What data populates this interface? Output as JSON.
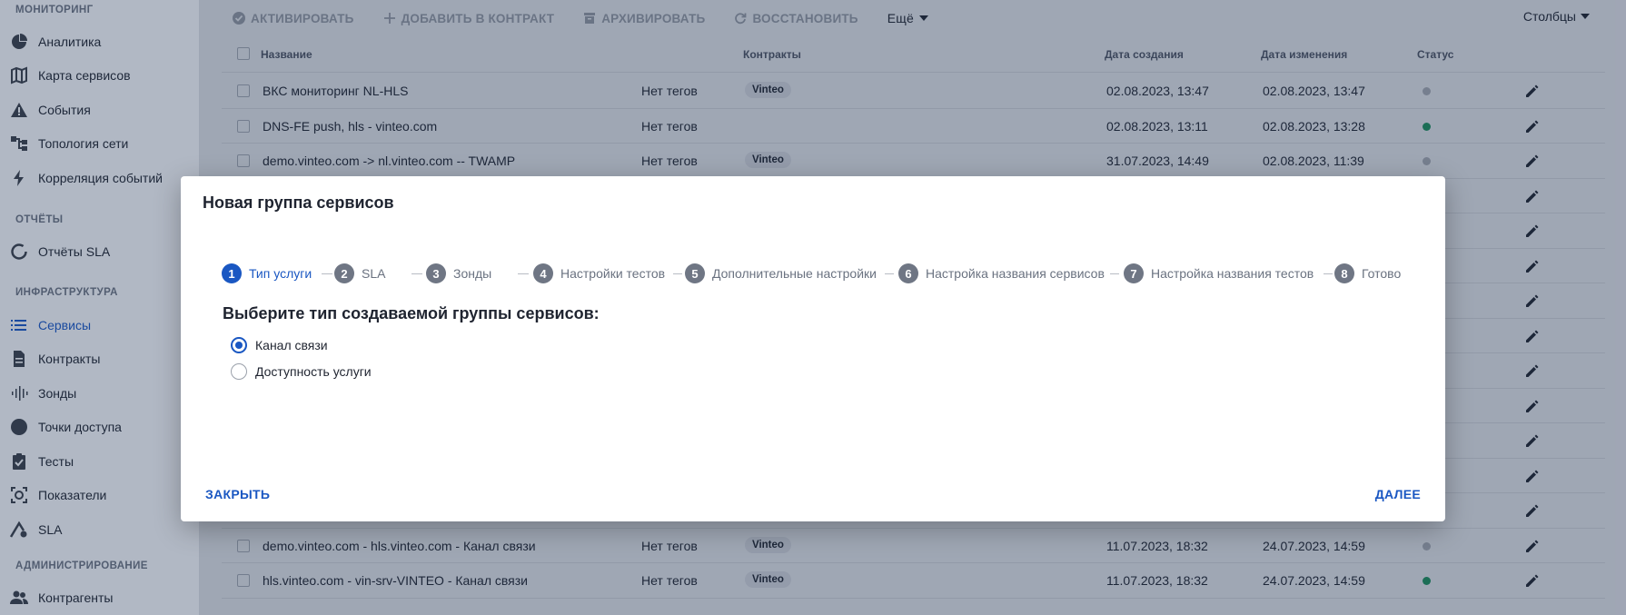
{
  "sidebar": {
    "sections": {
      "monitoring": "МОНИТОРИНГ",
      "reports": "ОТЧЁТЫ",
      "infrastructure": "ИНФРАСТРУКТУРА",
      "administration": "АДМИНИСТРИРОВАНИЕ"
    },
    "items": [
      {
        "label": "Аналитика",
        "icon": "pie-chart-icon"
      },
      {
        "label": "Карта сервисов",
        "icon": "map-icon"
      },
      {
        "label": "События",
        "icon": "warning-icon"
      },
      {
        "label": "Топология сети",
        "icon": "topology-icon"
      },
      {
        "label": "Корреляция событий",
        "icon": "lightning-icon"
      },
      {
        "label": "Отчёты SLA",
        "icon": "circle-progress-icon"
      },
      {
        "label": "Сервисы",
        "icon": "list-icon"
      },
      {
        "label": "Контракты",
        "icon": "document-icon"
      },
      {
        "label": "Зонды",
        "icon": "probe-icon"
      },
      {
        "label": "Точки доступа",
        "icon": "circle-icon"
      },
      {
        "label": "Тесты",
        "icon": "clipboard-check-icon"
      },
      {
        "label": "Показатели",
        "icon": "metrics-icon"
      },
      {
        "label": "SLA",
        "icon": "sla-icon"
      },
      {
        "label": "Контрагенты",
        "icon": "people-icon"
      }
    ]
  },
  "toolbar": {
    "activate": "АКТИВИРОВАТЬ",
    "add_contract": "ДОБАВИТЬ В КОНТРАКТ",
    "archive": "АРХИВИРОВАТЬ",
    "restore": "ВОССТАНОВИТЬ",
    "more": "Ещё",
    "columns": "Столбцы"
  },
  "table": {
    "headers": {
      "name": "Название",
      "contracts": "Контракты",
      "created": "Дата создания",
      "modified": "Дата изменения",
      "status": "Статус"
    },
    "rows": [
      {
        "name": "ВКС мониторинг NL-HLS",
        "tags": "Нет тегов",
        "contract": "Vinteo",
        "created": "02.08.2023, 13:47",
        "modified": "02.08.2023, 13:47",
        "status_color": "#9ea3ab"
      },
      {
        "name": "DNS-FE push, hls - vinteo.com",
        "tags": "Нет тегов",
        "contract": "",
        "created": "02.08.2023, 13:11",
        "modified": "02.08.2023, 13:28",
        "status_color": "#1e8a5a"
      },
      {
        "name": "demo.vinteo.com -> nl.vinteo.com -- TWAMP",
        "tags": "Нет тегов",
        "contract": "Vinteo",
        "created": "31.07.2023, 14:49",
        "modified": "02.08.2023, 11:39",
        "status_color": "#9ea3ab"
      },
      {
        "name": "demo.vinteo.com - hls.vinteo.com - Канал связи",
        "tags": "Нет тегов",
        "contract": "Vinteo",
        "created": "11.07.2023, 18:32",
        "modified": "24.07.2023, 14:59",
        "status_color": "#9ea3ab"
      },
      {
        "name": "hls.vinteo.com - vin-srv-VINTEO - Канал связи",
        "tags": "Нет тегов",
        "contract": "Vinteo",
        "created": "11.07.2023, 18:32",
        "modified": "24.07.2023, 14:59",
        "status_color": "#1e8a5a"
      }
    ]
  },
  "dialog": {
    "title": "Новая группа сервисов",
    "steps": [
      {
        "num": "1",
        "label": "Тип услуги"
      },
      {
        "num": "2",
        "label": "SLA"
      },
      {
        "num": "3",
        "label": "Зонды"
      },
      {
        "num": "4",
        "label": "Настройки тестов"
      },
      {
        "num": "5",
        "label": "Дополнительные настройки"
      },
      {
        "num": "6",
        "label": "Настройка названия сервисов"
      },
      {
        "num": "7",
        "label": "Настройка названия тестов"
      },
      {
        "num": "8",
        "label": "Готово"
      }
    ],
    "active_step": 1,
    "question": "Выберите тип создаваемой группы сервисов:",
    "options": [
      {
        "label": "Канал связи",
        "checked": true
      },
      {
        "label": "Доступность услуги",
        "checked": false
      }
    ],
    "close_label": "ЗАКРЫТЬ",
    "next_label": "ДАЛЕЕ"
  },
  "colors": {
    "accent": "#1a57c2",
    "status_ok": "#1e8a5a",
    "status_unknown": "#9ea3ab"
  }
}
